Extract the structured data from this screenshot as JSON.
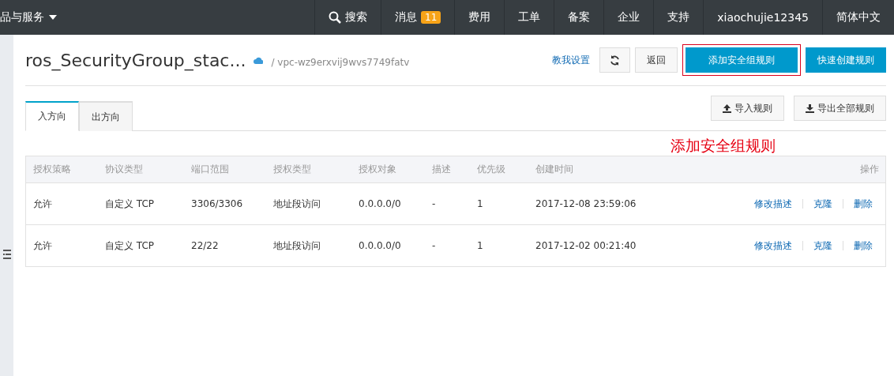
{
  "topbar": {
    "menu": "品与服务",
    "search": "搜索",
    "messages": {
      "label": "消息",
      "count": "11"
    },
    "items": [
      "费用",
      "工单",
      "备案",
      "企业",
      "支持",
      "xiaochujie12345",
      "简体中文"
    ]
  },
  "header": {
    "title": "ros_SecurityGroup_stac...",
    "vpc": "/ vpc-wz9erxvij9wvs7749fatv",
    "help_link": "教我设置",
    "back": "返回",
    "add_button": {
      "label": "添加安全组规则",
      "highlighted": true
    },
    "quick_button": "快速创建规则"
  },
  "tabs": [
    {
      "label": "入方向",
      "selected": true
    },
    {
      "label": "出方向",
      "selected": false
    }
  ],
  "tools": [
    {
      "label": "导入规则",
      "kind": "upload"
    },
    {
      "label": "导出全部规则",
      "kind": "download"
    }
  ],
  "annotation": "添加安全组规则",
  "table": {
    "columns": [
      "授权策略",
      "协议类型",
      "端口范围",
      "授权类型",
      "授权对象",
      "描述",
      "优先级",
      "创建时间",
      "操作"
    ],
    "rows": [
      {
        "cells": [
          "允许",
          "自定义 TCP",
          "3306/3306",
          "地址段访问",
          "0.0.0.0/0",
          "-",
          "1",
          "2017-12-08 23:59:06"
        ],
        "actions": [
          "修改描述",
          "克隆",
          "删除"
        ]
      },
      {
        "cells": [
          "允许",
          "自定义 TCP",
          "22/22",
          "地址段访问",
          "0.0.0.0/0",
          "-",
          "1",
          "2017-12-02 00:21:40"
        ],
        "actions": [
          "修改描述",
          "克隆",
          "删除"
        ]
      }
    ]
  }
}
